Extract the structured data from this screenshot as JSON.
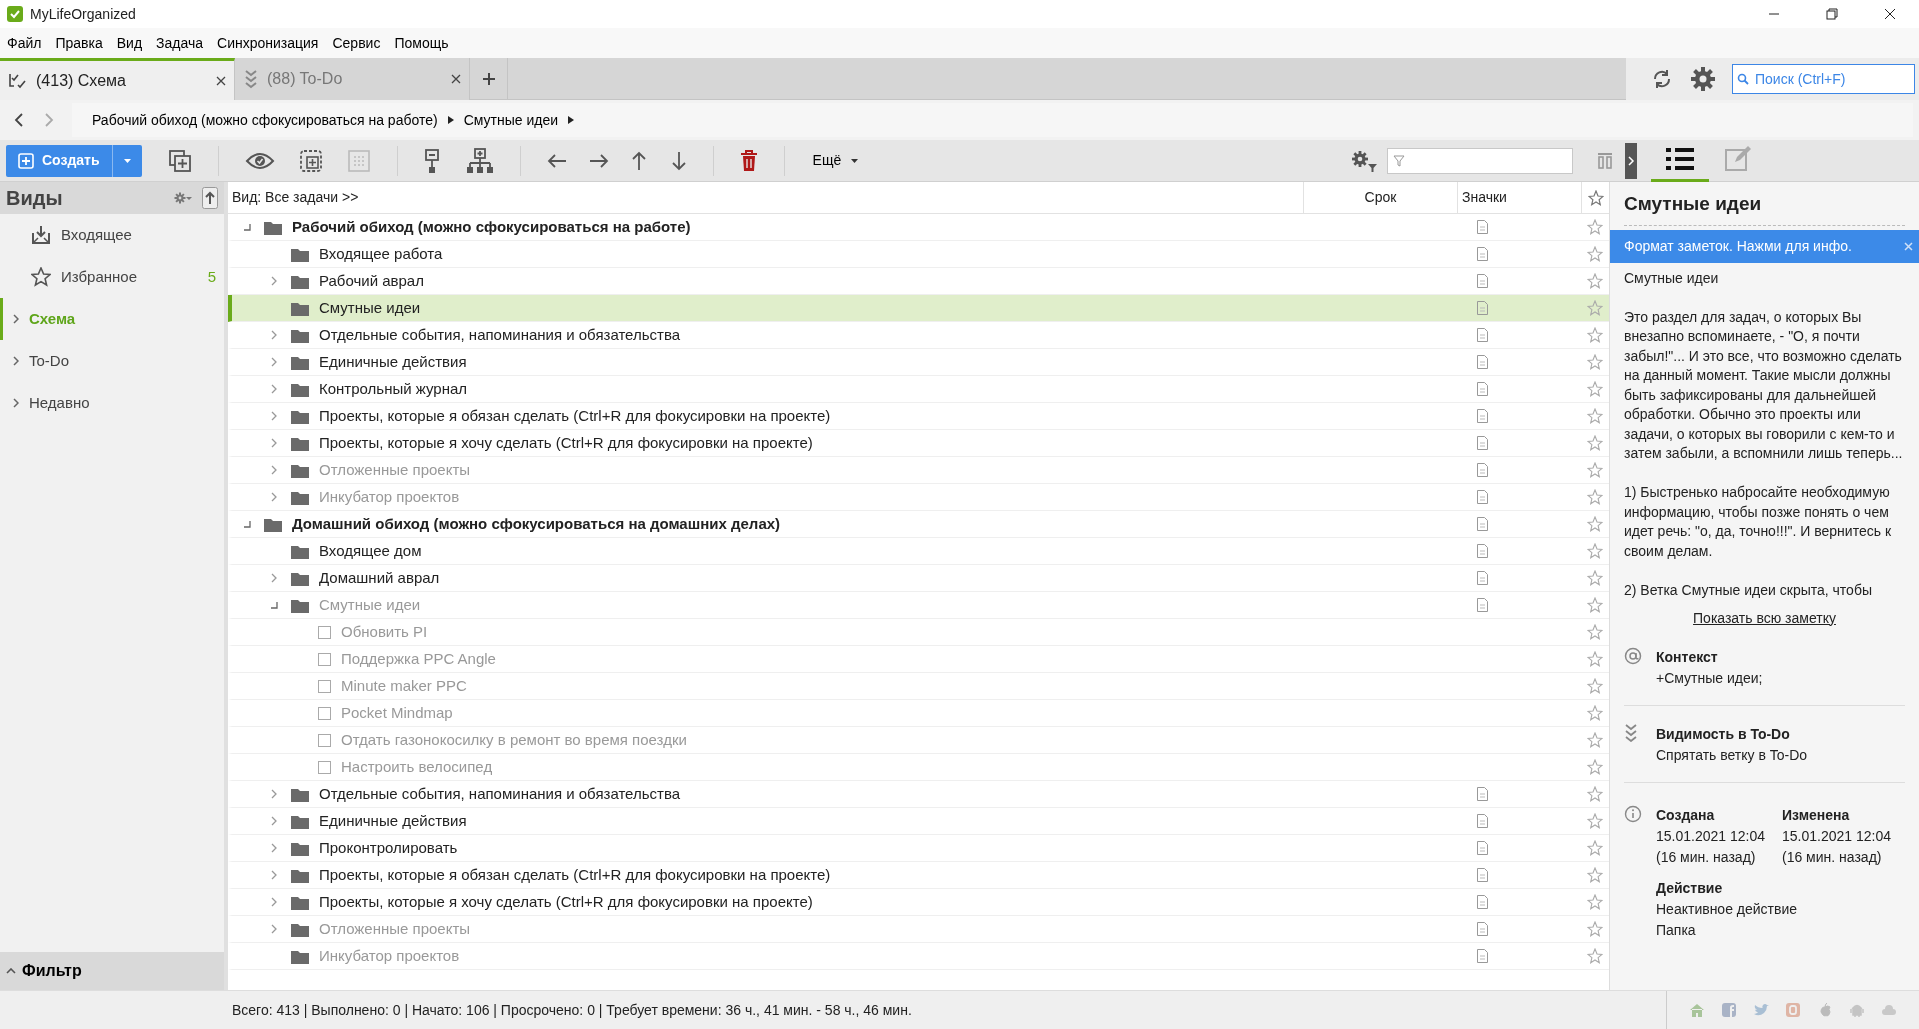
{
  "window": {
    "title": "MyLifeOrganized"
  },
  "menu": [
    "Файл",
    "Правка",
    "Вид",
    "Задача",
    "Синхронизация",
    "Сервис",
    "Помощь"
  ],
  "tabs": [
    {
      "label": "(413) Схема",
      "kind": "outline",
      "selected": true
    },
    {
      "label": "(88) To-Do",
      "kind": "todo",
      "selected": false
    }
  ],
  "search": {
    "placeholder": "Поиск (Ctrl+F)"
  },
  "breadcrumb": [
    "Рабочий обиход (можно сфокусироваться на работе)",
    "Смутные идеи"
  ],
  "toolbar": {
    "create_label": "Создать",
    "more_label": "Ещё"
  },
  "detail_tabs": [
    {
      "kind": "list",
      "selected": true
    },
    {
      "kind": "edit",
      "selected": false
    }
  ],
  "sidebar": {
    "title": "Виды",
    "items": [
      {
        "label": "Входящее",
        "kind": "inbox",
        "selected": false
      },
      {
        "label": "Избранное",
        "kind": "favorites",
        "count": "5",
        "selected": false
      },
      {
        "label": "Схема",
        "kind": "branch",
        "selected": true
      },
      {
        "label": "To-Do",
        "kind": "branch",
        "selected": false
      },
      {
        "label": "Недавно",
        "kind": "branch",
        "selected": false
      }
    ],
    "footer": "Фильтр"
  },
  "tree": {
    "view_label": "Вид: Все задачи >>",
    "columns": [
      "Срок",
      "Значки"
    ],
    "rows": [
      {
        "text": "Рабочий обиход (можно сфокусироваться на работе)",
        "kind": "folder",
        "has_children": true,
        "expanded": true,
        "inactive": false,
        "selected": false,
        "note": true,
        "children": [
          {
            "text": "Входящее работа",
            "kind": "folder",
            "has_children": false,
            "inactive": false,
            "selected": false,
            "note": true
          },
          {
            "text": "Рабочий аврал",
            "kind": "folder",
            "has_children": true,
            "expanded": false,
            "inactive": false,
            "selected": false,
            "note": true
          },
          {
            "text": "Смутные идеи",
            "kind": "folder",
            "has_children": false,
            "inactive": false,
            "selected": true,
            "note": true
          },
          {
            "text": "Отдельные события, напоминания и обязательства",
            "kind": "folder",
            "has_children": true,
            "expanded": false,
            "inactive": false,
            "selected": false,
            "note": true
          },
          {
            "text": "Единичные действия",
            "kind": "folder",
            "has_children": true,
            "expanded": false,
            "inactive": false,
            "selected": false,
            "note": true
          },
          {
            "text": "Контрольный журнал",
            "kind": "folder",
            "has_children": true,
            "expanded": false,
            "inactive": false,
            "selected": false,
            "note": true
          },
          {
            "text": "Проекты, которые я обязан сделать (Ctrl+R для фокусировки на проекте)",
            "kind": "folder",
            "has_children": true,
            "expanded": false,
            "inactive": false,
            "selected": false,
            "note": true
          },
          {
            "text": "Проекты, которые я хочу сделать  (Ctrl+R для фокусировки на проекте)",
            "kind": "folder",
            "has_children": true,
            "expanded": false,
            "inactive": false,
            "selected": false,
            "note": true
          },
          {
            "text": "Отложенные проекты",
            "kind": "folder",
            "has_children": true,
            "expanded": false,
            "inactive": true,
            "selected": false,
            "note": true
          },
          {
            "text": "Инкубатор проектов",
            "kind": "folder",
            "has_children": true,
            "expanded": false,
            "inactive": true,
            "selected": false,
            "note": true
          }
        ]
      },
      {
        "text": "Домашний обиход  (можно сфокусироваться на домашних делах)",
        "kind": "folder",
        "has_children": true,
        "expanded": true,
        "inactive": false,
        "selected": false,
        "note": true,
        "children": [
          {
            "text": "Входящее дом",
            "kind": "folder",
            "has_children": false,
            "inactive": false,
            "selected": false,
            "note": true
          },
          {
            "text": "Домашний аврал",
            "kind": "folder",
            "has_children": true,
            "expanded": false,
            "inactive": false,
            "selected": false,
            "note": true
          },
          {
            "text": "Смутные идеи",
            "kind": "folder",
            "has_children": true,
            "expanded": true,
            "inactive": true,
            "selected": false,
            "note": true,
            "children": [
              {
                "text": "Обновить PI",
                "kind": "task",
                "checked": false,
                "has_children": false,
                "inactive": true,
                "selected": false,
                "note": false
              },
              {
                "text": "Поддержка PPC Angle",
                "kind": "task",
                "checked": false,
                "has_children": false,
                "inactive": true,
                "selected": false,
                "note": false
              },
              {
                "text": "Minute maker PPC",
                "kind": "task",
                "checked": false,
                "has_children": false,
                "inactive": true,
                "selected": false,
                "note": false
              },
              {
                "text": "Pocket Mindmap",
                "kind": "task",
                "checked": false,
                "has_children": false,
                "inactive": true,
                "selected": false,
                "note": false
              },
              {
                "text": "Отдать газонокосилку в ремонт во время поездки",
                "kind": "task",
                "checked": false,
                "has_children": false,
                "inactive": true,
                "selected": false,
                "note": false
              },
              {
                "text": "Настроить велосипед",
                "kind": "task",
                "checked": false,
                "has_children": false,
                "inactive": true,
                "selected": false,
                "note": false
              }
            ]
          },
          {
            "text": "Отдельные события, напоминания и обязательства",
            "kind": "folder",
            "has_children": true,
            "expanded": false,
            "inactive": false,
            "selected": false,
            "note": true
          },
          {
            "text": "Единичные действия",
            "kind": "folder",
            "has_children": true,
            "expanded": false,
            "inactive": false,
            "selected": false,
            "note": true
          },
          {
            "text": "Проконтролировать",
            "kind": "folder",
            "has_children": true,
            "expanded": false,
            "inactive": false,
            "selected": false,
            "note": true
          },
          {
            "text": "Проекты, которые я обязан сделать  (Ctrl+R для фокусировки на проекте)",
            "kind": "folder",
            "has_children": true,
            "expanded": false,
            "inactive": false,
            "selected": false,
            "note": true
          },
          {
            "text": "Проекты, которые я хочу сделать  (Ctrl+R для фокусировки на проекте)",
            "kind": "folder",
            "has_children": true,
            "expanded": false,
            "inactive": false,
            "selected": false,
            "note": true
          },
          {
            "text": "Отложенные проекты",
            "kind": "folder",
            "has_children": true,
            "expanded": false,
            "inactive": true,
            "selected": false,
            "note": true
          },
          {
            "text": "Инкубатор проектов",
            "kind": "folder",
            "has_children": false,
            "inactive": true,
            "selected": false,
            "note": true
          }
        ]
      }
    ]
  },
  "details": {
    "title": "Смутные идеи",
    "banner": "Формат заметок. Нажми для инфо.",
    "note": [
      "Смутные идеи",
      "Это раздел для задач, о которых Вы внезапно вспоминаете, - \"О, я почти забыл!\"... И это все, что возможно сделать на данный момент. Такие мысли должны быть зафиксированы для дальнейшей обработки. Обычно это проекты или задачи, о которых вы говорили с кем-то и затем забыли, а вспомнили лишь теперь...",
      "1) Быстренько набросайте необходимую информацию, чтобы позже понять о чем идет речь: \"о, да, точно!!!\". И вернитесь к своим делам.",
      "2) Ветка Смутные идеи скрыта, чтобы"
    ],
    "show_all": "Показать всю заметку",
    "sections": [
      {
        "kind": "context",
        "label": "Контекст",
        "values": [
          "+Смутные идеи;"
        ]
      },
      {
        "kind": "visibility",
        "label": "Видимость в To-Do",
        "values": [
          "Спрятать ветку в To-Do"
        ]
      },
      {
        "kind": "dates",
        "items": [
          {
            "label": "Создана",
            "value": "15.01.2021 12:04 (16 мин. назад)"
          },
          {
            "label": "Изменена",
            "value": "15.01.2021 12:04 (16 мин. назад)"
          }
        ]
      },
      {
        "kind": "action",
        "label": "Действие",
        "values": [
          "Неактивное действие",
          "Папка"
        ]
      }
    ]
  },
  "status_bar": "Всего: 413 | Выполнено: 0 | Начато: 106 | Просрочено: 0 | Требует времени: 36 ч., 41 мин. - 58 ч., 46 мин."
}
